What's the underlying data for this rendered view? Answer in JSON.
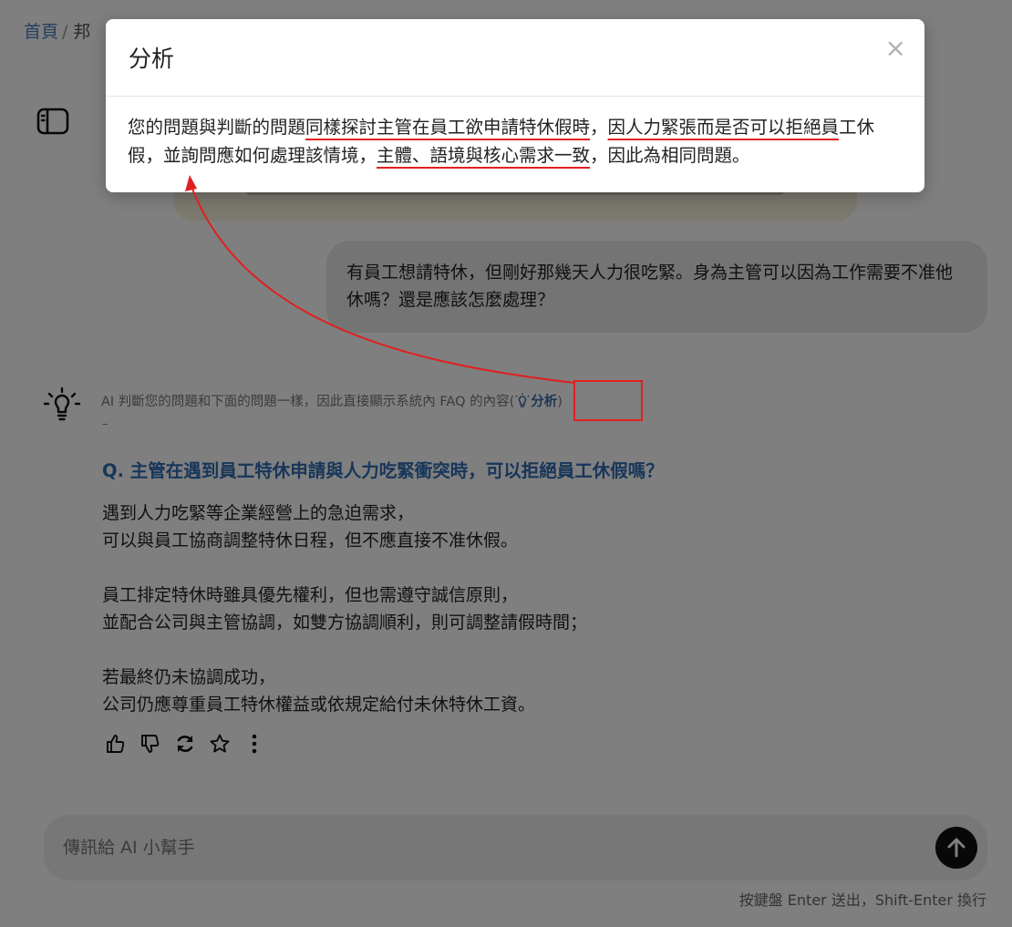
{
  "breadcrumb": {
    "home": "首頁",
    "sep": "/",
    "current": "邦"
  },
  "user_message": "有員工想請特休，但剛好那幾天人力很吃緊。身為主管可以因為工作需要不准他休嗎？還是應該怎麼處理？",
  "ai": {
    "meta_text": "AI 判斷您的問題和下面的問題一樣，因此直接顯示系統內 FAQ 的內容(",
    "analysis_label": "分析",
    "meta_close": ")",
    "separator": "–",
    "question": "Q. 主管在遇到員工特休申請與人力吃緊衝突時，可以拒絕員工休假嗎？",
    "answer": [
      [
        "遇到人力吃緊等企業經營上的急迫需求，",
        "可以與員工協商調整特休日程，但不應直接不准休假。"
      ],
      [
        "員工排定特休時雖具優先權利，但也需遵守誠信原則，",
        "並配合公司與主管協調，如雙方協調順利，則可調整請假時間；"
      ],
      [
        "若最終仍未協調成功，",
        "公司仍應尊重員工特休權益或依規定給付未休特休工資。"
      ]
    ],
    "actions": [
      "thumb-up-icon",
      "thumb-down-icon",
      "refresh-icon",
      "star-icon",
      "more-icon"
    ]
  },
  "chat": {
    "placeholder": "傳訊給 AI 小幫手",
    "hint": "按鍵盤 Enter 送出，Shift-Enter 換行"
  },
  "modal": {
    "title": "分析",
    "close": "×",
    "body_parts": [
      {
        "text": "您的問題與判斷的問題",
        "underline": false
      },
      {
        "text": "同樣探討主管在員工欲申請特休假時",
        "underline": true
      },
      {
        "text": "，",
        "underline": false
      },
      {
        "text": "因人力緊張而是否可以拒絕員",
        "underline": true
      },
      {
        "text": "工休假，並詢問應如何處理該情境，",
        "underline": false
      },
      {
        "text": "主體、語境與核心需求一致",
        "underline": true
      },
      {
        "text": "，因此為相同問題。",
        "underline": false
      }
    ]
  },
  "colors": {
    "accent": "#2e6db4",
    "annotation": "#e02020",
    "overlay": "rgba(0,0,0,0.5)"
  }
}
